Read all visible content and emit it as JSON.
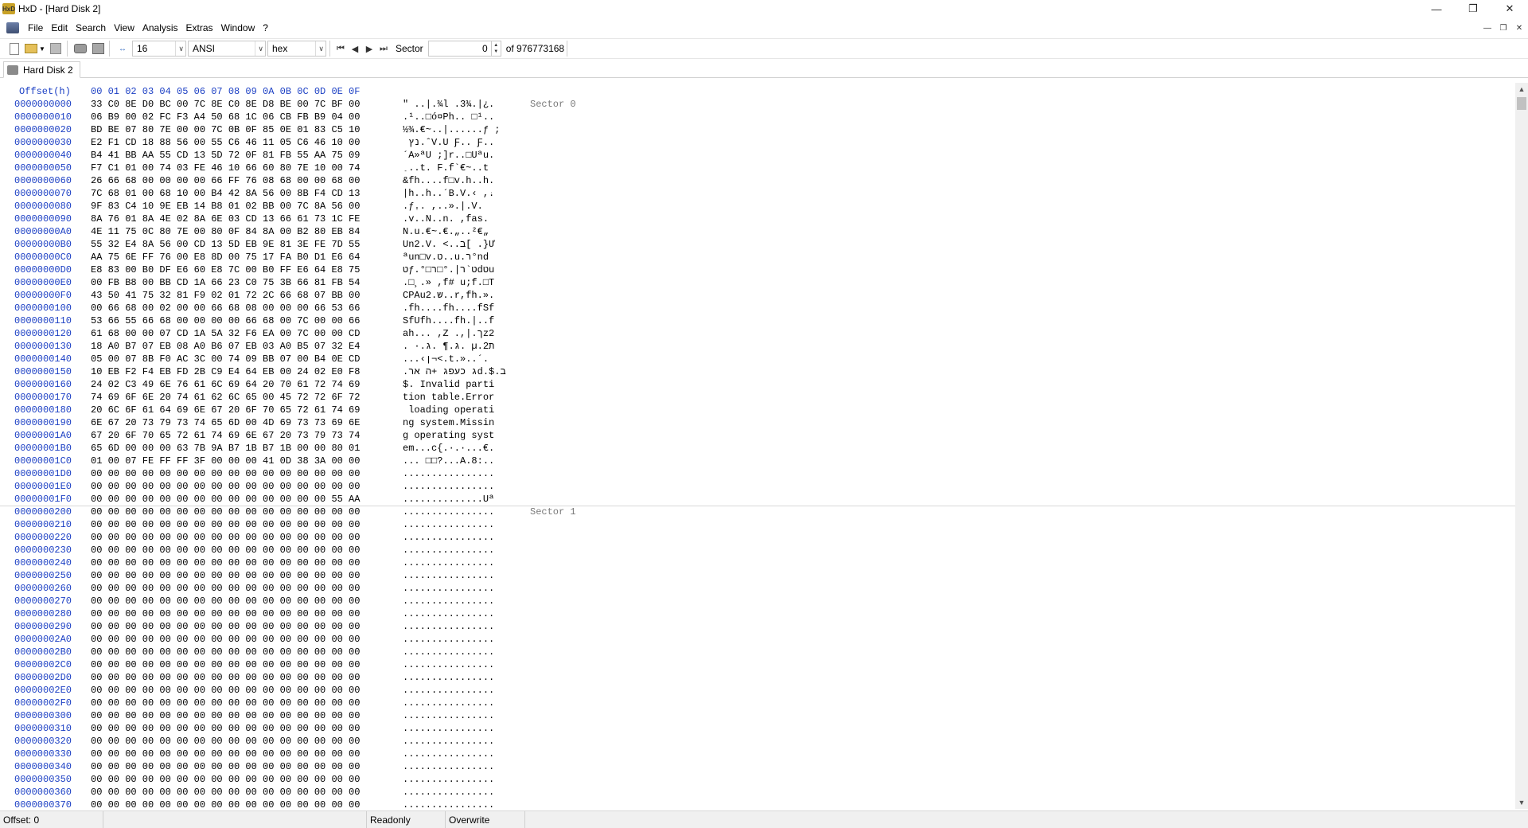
{
  "window": {
    "title": "HxD - [Hard Disk 2]",
    "app_icon": "hxd-app-icon",
    "controls": [
      "minimize-icon",
      "restore-icon",
      "close-icon"
    ]
  },
  "menu": {
    "items": [
      "File",
      "Edit",
      "Search",
      "View",
      "Analysis",
      "Extras",
      "Window",
      "?"
    ],
    "mdi_controls": [
      "mdi-minimize-icon",
      "mdi-restore-icon",
      "mdi-close-icon"
    ]
  },
  "toolbar": {
    "bytes_per_row": "16",
    "charset": "ANSI",
    "offset_base": "hex",
    "sector_label": "Sector",
    "sector_value": "0",
    "sector_total": "of 976773168"
  },
  "tab": {
    "label": "Hard Disk 2"
  },
  "hex": {
    "offset_header": "Offset(h)",
    "column_header": "00 01 02 03 04 05 06 07 08 09 0A 0B 0C 0D 0E 0F",
    "sector_labels": [
      "Sector 0",
      "Sector 1"
    ],
    "rows": [
      {
        "off": "0000000000",
        "hex": "33 C0 8E D0 BC 00 7C 8E C0 8E D8 BE 00 7C BF 00",
        "txt": "\" ..|.¾l .3¾.|¿."
      },
      {
        "off": "0000000010",
        "hex": "06 B9 00 02 FC F3 A4 50 68 1C 06 CB FB B9 04 00",
        "txt": ".¹..□ó¤Ph.. □¹.."
      },
      {
        "off": "0000000020",
        "hex": "BD BE 07 80 7E 00 00 7C 0B 0F 85 0E 01 83 C5 10",
        "txt": "½¾.€~..|......ƒ ;"
      },
      {
        "off": "0000000030",
        "hex": "E2 F1 CD 18 88 56 00 55 C6 46 11 05 C6 46 10 00",
        "txt": " נץ.ˆV.U Ƒ.. Ƒ.."
      },
      {
        "off": "0000000040",
        "hex": "B4 41 BB AA 55 CD 13 5D 72 0F 81 FB 55 AA 75 09",
        "txt": "´A»ªU ;]r..□Uªu."
      },
      {
        "off": "0000000050",
        "hex": "F7 C1 01 00 74 03 FE 46 10 66 60 80 7E 10 00 74",
        "txt": " ַ..t. F.f`€~..t"
      },
      {
        "off": "0000000060",
        "hex": "26 66 68 00 00 00 00 66 FF 76 08 68 00 00 68 00",
        "txt": "&fh....f□v.h..h."
      },
      {
        "off": "0000000070",
        "hex": "7C 68 01 00 68 10 00 B4 42 8A 56 00 8B F4 CD 13",
        "txt": "|h..h..´B.V.‹ ,ּ."
      },
      {
        "off": "0000000080",
        "hex": "9F 83 C4 10 9E EB 14 B8 01 02 BB 00 7C 8A 56 00",
        "txt": ".ƒִ.. ,..».|.V."
      },
      {
        "off": "0000000090",
        "hex": "8A 76 01 8A 4E 02 8A 6E 03 CD 13 66 61 73 1C FE",
        "txt": ".v..N..n. ,fas."
      },
      {
        "off": "00000000A0",
        "hex": "4E 11 75 0C 80 7E 00 80 0F 84 8A 00 B2 80 EB 84",
        "txt": "N.u.€~.€.„..²€„"
      },
      {
        "off": "00000000B0",
        "hex": "55 32 E4 8A 56 00 CD 13 5D EB 9E 81 3E FE 7D 55",
        "txt": "Un2.V. <..ב[ .}Ư"
      },
      {
        "off": "00000000C0",
        "hex": "AA 75 6E FF 76 00 E8 8D 00 75 17 FA B0 D1 E6 64",
        "txt": "ªun□v.ט..u.ר°nd"
      },
      {
        "off": "00000000D0",
        "hex": "E8 83 00 B0 DF E6 60 E8 7C 00 B0 FF E6 64 E8 75",
        "txt": "טƒ.°□ט`ר|.°□רdטu"
      },
      {
        "off": "00000000E0",
        "hex": "00 FB B8 00 BB CD 1A 66 23 C0 75 3B 66 81 FB 54",
        "txt": ".□¸.» ,f# ‫u;f.□T"
      },
      {
        "off": "00000000F0",
        "hex": "43 50 41 75 32 81 F9 02 01 72 2C 66 68 07 BB 00",
        "txt": "CPAu2.ש..r,fh.»."
      },
      {
        "off": "0000000100",
        "hex": "00 66 68 00 02 00 00 66 68 08 00 00 00 66 53 66",
        "txt": ".fh....fh....fSf"
      },
      {
        "off": "0000000110",
        "hex": "53 66 55 66 68 00 00 00 00 66 68 00 7C 00 00 66",
        "txt": "SfUfh....fh.|..f"
      },
      {
        "off": "0000000120",
        "hex": "61 68 00 00 07 CD 1A 5A 32 F6 EA 00 7C 00 00 CD",
        "txt": "ah... ,Z .,|.ךz2"
      },
      {
        "off": "0000000130",
        "hex": "18 A0 B7 07 EB 08 A0 B6 07 EB 03 A0 B5 07 32 E4",
        "txt": ". ·.ג.¶ .ג. µ.ת2"
      },
      {
        "off": "0000000140",
        "hex": "05 00 07 8B F0 AC 3C 00 74 09 BB 07 00 B4 0E CD",
        "txt": "...‹ן¬<.t.»..´."
      },
      {
        "off": "0000000150",
        "hex": "10 EB F2 F4 EB FD 2B C9 E4 64 EB 00 24 02 E0 F8",
        "txt": ".ג כעפג +ה ארd.$.ב"
      },
      {
        "off": "0000000160",
        "hex": "24 02 C3 49 6E 76 61 6C 69 64 20 70 61 72 74 69",
        "txt": "$. Invalid parti"
      },
      {
        "off": "0000000170",
        "hex": "74 69 6F 6E 20 74 61 62 6C 65 00 45 72 72 6F 72",
        "txt": "tion table.Error"
      },
      {
        "off": "0000000180",
        "hex": "20 6C 6F 61 64 69 6E 67 20 6F 70 65 72 61 74 69",
        "txt": " loading operati"
      },
      {
        "off": "0000000190",
        "hex": "6E 67 20 73 79 73 74 65 6D 00 4D 69 73 73 69 6E",
        "txt": "ng system.Missin"
      },
      {
        "off": "00000001A0",
        "hex": "67 20 6F 70 65 72 61 74 69 6E 67 20 73 79 73 74",
        "txt": "g operating syst"
      },
      {
        "off": "00000001B0",
        "hex": "65 6D 00 00 00 63 7B 9A B7 1B B7 1B 00 00 80 01",
        "txt": "em...c{.·.·...€."
      },
      {
        "off": "00000001C0",
        "hex": "01 00 07 FE FF FF 3F 00 00 00 41 0D 38 3A 00 00",
        "txt": "... □□?...A.8:.."
      },
      {
        "off": "00000001D0",
        "hex": "00 00 00 00 00 00 00 00 00 00 00 00 00 00 00 00",
        "txt": "................"
      },
      {
        "off": "00000001E0",
        "hex": "00 00 00 00 00 00 00 00 00 00 00 00 00 00 00 00",
        "txt": "................"
      },
      {
        "off": "00000001F0",
        "hex": "00 00 00 00 00 00 00 00 00 00 00 00 00 00 55 AA",
        "txt": "..............Uª"
      },
      {
        "off": "0000000200",
        "hex": "00 00 00 00 00 00 00 00 00 00 00 00 00 00 00 00",
        "txt": "................"
      },
      {
        "off": "0000000210",
        "hex": "00 00 00 00 00 00 00 00 00 00 00 00 00 00 00 00",
        "txt": "................"
      },
      {
        "off": "0000000220",
        "hex": "00 00 00 00 00 00 00 00 00 00 00 00 00 00 00 00",
        "txt": "................"
      },
      {
        "off": "0000000230",
        "hex": "00 00 00 00 00 00 00 00 00 00 00 00 00 00 00 00",
        "txt": "................"
      },
      {
        "off": "0000000240",
        "hex": "00 00 00 00 00 00 00 00 00 00 00 00 00 00 00 00",
        "txt": "................"
      },
      {
        "off": "0000000250",
        "hex": "00 00 00 00 00 00 00 00 00 00 00 00 00 00 00 00",
        "txt": "................"
      },
      {
        "off": "0000000260",
        "hex": "00 00 00 00 00 00 00 00 00 00 00 00 00 00 00 00",
        "txt": "................"
      },
      {
        "off": "0000000270",
        "hex": "00 00 00 00 00 00 00 00 00 00 00 00 00 00 00 00",
        "txt": "................"
      },
      {
        "off": "0000000280",
        "hex": "00 00 00 00 00 00 00 00 00 00 00 00 00 00 00 00",
        "txt": "................"
      },
      {
        "off": "0000000290",
        "hex": "00 00 00 00 00 00 00 00 00 00 00 00 00 00 00 00",
        "txt": "................"
      },
      {
        "off": "00000002A0",
        "hex": "00 00 00 00 00 00 00 00 00 00 00 00 00 00 00 00",
        "txt": "................"
      },
      {
        "off": "00000002B0",
        "hex": "00 00 00 00 00 00 00 00 00 00 00 00 00 00 00 00",
        "txt": "................"
      },
      {
        "off": "00000002C0",
        "hex": "00 00 00 00 00 00 00 00 00 00 00 00 00 00 00 00",
        "txt": "................"
      },
      {
        "off": "00000002D0",
        "hex": "00 00 00 00 00 00 00 00 00 00 00 00 00 00 00 00",
        "txt": "................"
      },
      {
        "off": "00000002E0",
        "hex": "00 00 00 00 00 00 00 00 00 00 00 00 00 00 00 00",
        "txt": "................"
      },
      {
        "off": "00000002F0",
        "hex": "00 00 00 00 00 00 00 00 00 00 00 00 00 00 00 00",
        "txt": "................"
      },
      {
        "off": "0000000300",
        "hex": "00 00 00 00 00 00 00 00 00 00 00 00 00 00 00 00",
        "txt": "................"
      },
      {
        "off": "0000000310",
        "hex": "00 00 00 00 00 00 00 00 00 00 00 00 00 00 00 00",
        "txt": "................"
      },
      {
        "off": "0000000320",
        "hex": "00 00 00 00 00 00 00 00 00 00 00 00 00 00 00 00",
        "txt": "................"
      },
      {
        "off": "0000000330",
        "hex": "00 00 00 00 00 00 00 00 00 00 00 00 00 00 00 00",
        "txt": "................"
      },
      {
        "off": "0000000340",
        "hex": "00 00 00 00 00 00 00 00 00 00 00 00 00 00 00 00",
        "txt": "................"
      },
      {
        "off": "0000000350",
        "hex": "00 00 00 00 00 00 00 00 00 00 00 00 00 00 00 00",
        "txt": "................"
      },
      {
        "off": "0000000360",
        "hex": "00 00 00 00 00 00 00 00 00 00 00 00 00 00 00 00",
        "txt": "................"
      },
      {
        "off": "0000000370",
        "hex": "00 00 00 00 00 00 00 00 00 00 00 00 00 00 00 00",
        "txt": "................"
      }
    ]
  },
  "status": {
    "offset": "Offset: 0",
    "mode": "Readonly",
    "insert_mode": "Overwrite"
  },
  "colors": {
    "offset_blue": "#1b3fc4",
    "sector_gray": "#7a7a7a"
  }
}
